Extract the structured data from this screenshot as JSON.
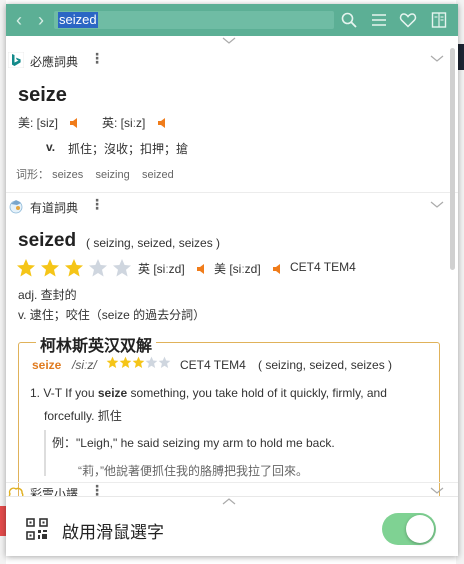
{
  "search": {
    "value": "seized"
  },
  "bing": {
    "dict_name": "必應詞典",
    "menu": "⋮",
    "word": "seize",
    "us_label": "美: [siz]",
    "uk_label": "英: [siːz]",
    "pos": "v.",
    "meaning": "抓住；沒收；扣押；搶",
    "forms_label": "词形：",
    "forms": [
      "seizes",
      "seizing",
      "seized"
    ]
  },
  "youdao": {
    "dict_name": "有道詞典",
    "menu": "⋮",
    "word": "seized",
    "inflections": "( seizing, seized, seizes )",
    "rating": 3,
    "uk_label": "英 [siːzd]",
    "us_label": "美 [siːzd]",
    "exams": "CET4 TEM4",
    "def1": "adj. 查封的",
    "def2": "v. 逮住；咬住（seize 的過去分詞）"
  },
  "collins": {
    "title": "柯林斯英汉双解",
    "word": "seize",
    "phonetic": "/siːz/",
    "rating": 3,
    "exams": "CET4 TEM4",
    "inflections": "( seizing, seized, seizes )",
    "sense_num": "1.",
    "sense_type": "V-T",
    "sense_pre": "If you ",
    "sense_word": "seize",
    "sense_post": " something, you take hold of it quickly, firmly, and",
    "sense_line2": "forcefully. 抓住",
    "example_label": "例：",
    "example_en": "\"Leigh,\" he said seizing my arm to hold me back.",
    "example_zh": "“莉，”他說著便抓住我的胳膊把我拉了回來。"
  },
  "caiyun": {
    "dict_name": "彩雲小譯",
    "menu": "⋮"
  },
  "footer": {
    "toggle_label": "啟用滑鼠選字",
    "toggle_on": true
  },
  "colors": {
    "accent": "#5caf95",
    "speaker": "#f07c1a",
    "star": "#f5c518",
    "toggle": "#7fd293"
  }
}
